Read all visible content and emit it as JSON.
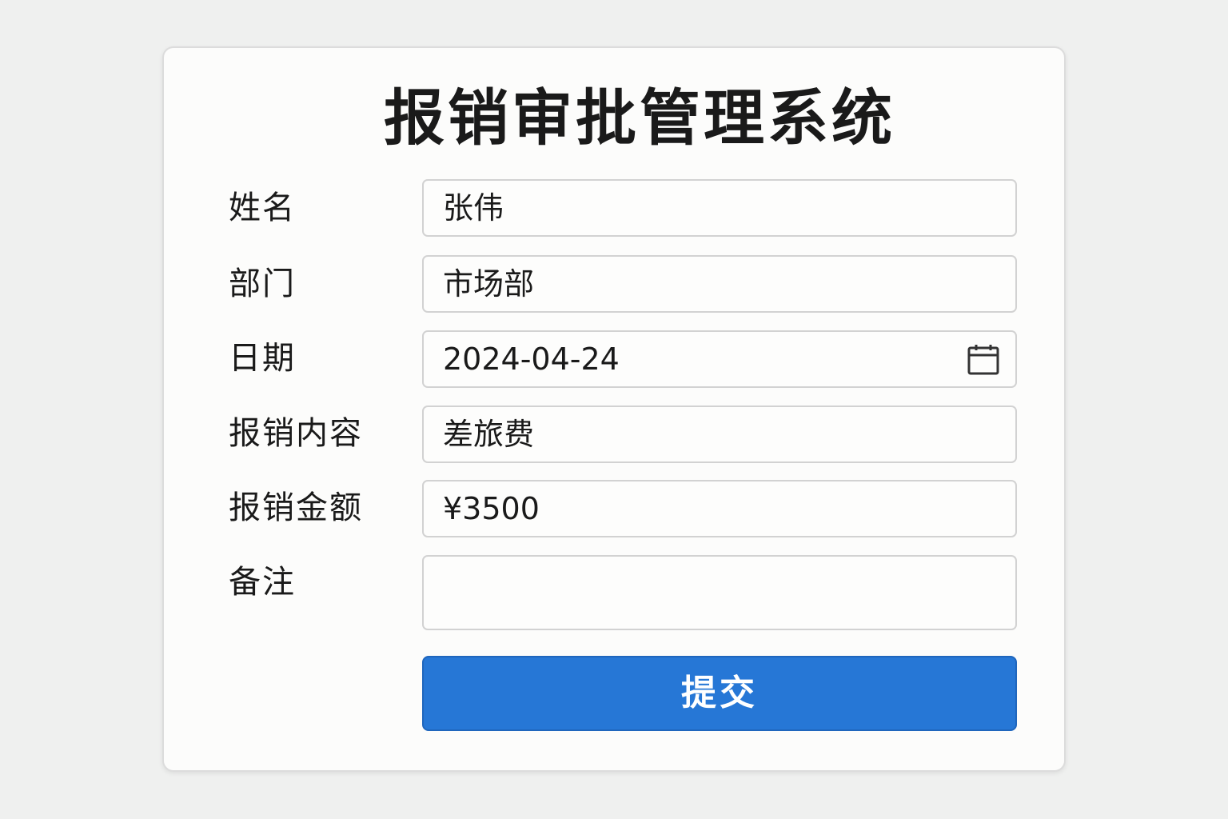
{
  "form": {
    "title": "报销审批管理系统",
    "fields": {
      "name": {
        "label": "姓名",
        "value": "张伟"
      },
      "department": {
        "label": "部门",
        "value": "市场部"
      },
      "date": {
        "label": "日期",
        "value": "2024-04-24",
        "icon": "calendar-icon"
      },
      "content": {
        "label": "报销内容",
        "value": "差旅费"
      },
      "amount": {
        "label": "报销金额",
        "value": "¥3500"
      },
      "remarks": {
        "label": "备注",
        "value": ""
      }
    },
    "submit_label": "提交"
  },
  "colors": {
    "background": "#eff0ef",
    "card": "#fcfcfb",
    "accent": "#2677d6",
    "text": "#1a1a1a",
    "border": "#d2d2d2"
  }
}
